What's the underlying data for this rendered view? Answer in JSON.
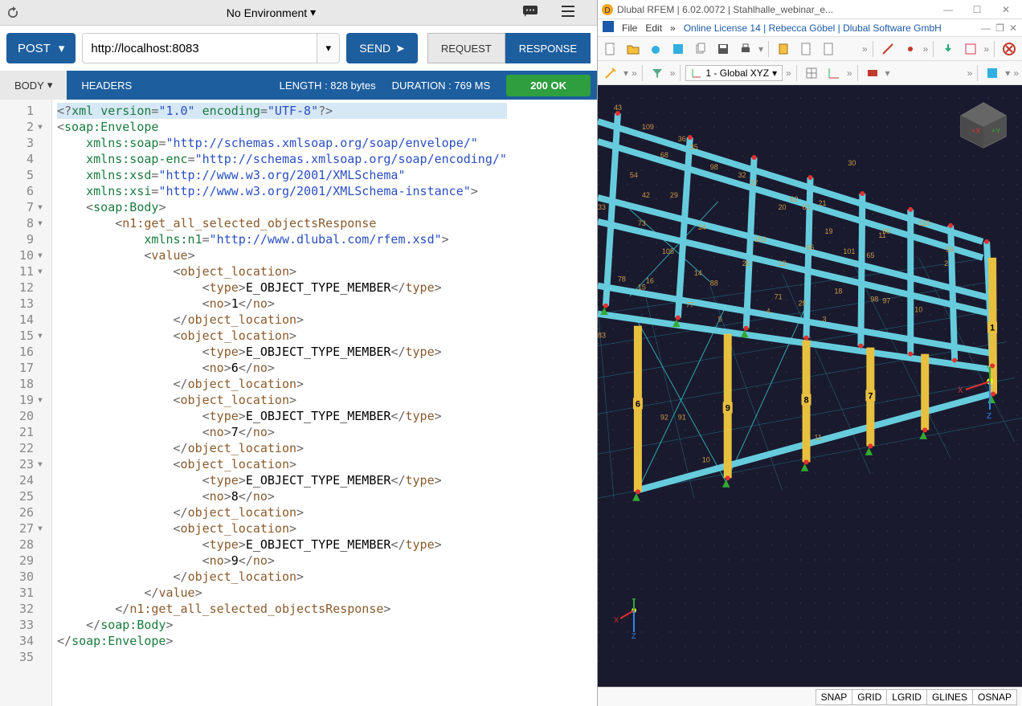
{
  "left": {
    "env_label": "No Environment",
    "method": "POST",
    "url": "http://localhost:8083",
    "send_label": "SEND",
    "request_tab": "REQUEST",
    "response_tab": "RESPONSE",
    "body_tab": "BODY",
    "headers_tab": "HEADERS",
    "length_label": "LENGTH : 828 bytes",
    "duration_label": "DURATION : 769 MS",
    "status_label": "200 OK",
    "code_lines": [
      {
        "n": 1,
        "fold": "",
        "hl": true,
        "html": "<span class='c-punc'>&lt;?</span><span class='c-tag'>xml</span> <span class='c-attr'>version</span><span class='c-punc'>=</span><span class='c-str'>\"1.0\"</span> <span class='c-attr'>encoding</span><span class='c-punc'>=</span><span class='c-str'>\"UTF-8\"</span><span class='c-punc'>?&gt;</span>"
      },
      {
        "n": 2,
        "fold": "▾",
        "html": "<span class='c-punc'>&lt;</span><span class='c-tag'>soap:Envelope</span>"
      },
      {
        "n": 3,
        "fold": "",
        "html": "    <span class='c-attr'>xmlns:soap</span><span class='c-punc'>=</span><span class='c-str'>\"http://schemas.xmlsoap.org/soap/envelope/\"</span>"
      },
      {
        "n": 4,
        "fold": "",
        "html": "    <span class='c-attr'>xmlns:soap-enc</span><span class='c-punc'>=</span><span class='c-str'>\"http://schemas.xmlsoap.org/soap/encoding/\"</span>"
      },
      {
        "n": 5,
        "fold": "",
        "html": "    <span class='c-attr'>xmlns:xsd</span><span class='c-punc'>=</span><span class='c-str'>\"http://www.w3.org/2001/XMLSchema\"</span>"
      },
      {
        "n": 6,
        "fold": "",
        "html": "    <span class='c-attr'>xmlns:xsi</span><span class='c-punc'>=</span><span class='c-str'>\"http://www.w3.org/2001/XMLSchema-instance\"</span><span class='c-punc'>&gt;</span>"
      },
      {
        "n": 7,
        "fold": "▾",
        "html": "    <span class='c-punc'>&lt;</span><span class='c-tag'>soap:Body</span><span class='c-punc'>&gt;</span>"
      },
      {
        "n": 8,
        "fold": "▾",
        "html": "        <span class='c-punc'>&lt;</span><span class='c-brown'>n1:get_all_selected_objectsResponse</span>"
      },
      {
        "n": 9,
        "fold": "",
        "html": "            <span class='c-attr'>xmlns:n1</span><span class='c-punc'>=</span><span class='c-str'>\"http://www.dlubal.com/rfem.xsd\"</span><span class='c-punc'>&gt;</span>"
      },
      {
        "n": 10,
        "fold": "▾",
        "html": "            <span class='c-punc'>&lt;</span><span class='c-brown'>value</span><span class='c-punc'>&gt;</span>"
      },
      {
        "n": 11,
        "fold": "▾",
        "html": "                <span class='c-punc'>&lt;</span><span class='c-brown'>object_location</span><span class='c-punc'>&gt;</span>"
      },
      {
        "n": 12,
        "fold": "",
        "html": "                    <span class='c-punc'>&lt;</span><span class='c-brown'>type</span><span class='c-punc'>&gt;</span><span class='c-text'>E_OBJECT_TYPE_MEMBER</span><span class='c-punc'>&lt;/</span><span class='c-brown'>type</span><span class='c-punc'>&gt;</span>"
      },
      {
        "n": 13,
        "fold": "",
        "html": "                    <span class='c-punc'>&lt;</span><span class='c-brown'>no</span><span class='c-punc'>&gt;</span><span class='c-text'>1</span><span class='c-punc'>&lt;/</span><span class='c-brown'>no</span><span class='c-punc'>&gt;</span>"
      },
      {
        "n": 14,
        "fold": "",
        "html": "                <span class='c-punc'>&lt;/</span><span class='c-brown'>object_location</span><span class='c-punc'>&gt;</span>"
      },
      {
        "n": 15,
        "fold": "▾",
        "html": "                <span class='c-punc'>&lt;</span><span class='c-brown'>object_location</span><span class='c-punc'>&gt;</span>"
      },
      {
        "n": 16,
        "fold": "",
        "html": "                    <span class='c-punc'>&lt;</span><span class='c-brown'>type</span><span class='c-punc'>&gt;</span><span class='c-text'>E_OBJECT_TYPE_MEMBER</span><span class='c-punc'>&lt;/</span><span class='c-brown'>type</span><span class='c-punc'>&gt;</span>"
      },
      {
        "n": 17,
        "fold": "",
        "html": "                    <span class='c-punc'>&lt;</span><span class='c-brown'>no</span><span class='c-punc'>&gt;</span><span class='c-text'>6</span><span class='c-punc'>&lt;/</span><span class='c-brown'>no</span><span class='c-punc'>&gt;</span>"
      },
      {
        "n": 18,
        "fold": "",
        "html": "                <span class='c-punc'>&lt;/</span><span class='c-brown'>object_location</span><span class='c-punc'>&gt;</span>"
      },
      {
        "n": 19,
        "fold": "▾",
        "html": "                <span class='c-punc'>&lt;</span><span class='c-brown'>object_location</span><span class='c-punc'>&gt;</span>"
      },
      {
        "n": 20,
        "fold": "",
        "html": "                    <span class='c-punc'>&lt;</span><span class='c-brown'>type</span><span class='c-punc'>&gt;</span><span class='c-text'>E_OBJECT_TYPE_MEMBER</span><span class='c-punc'>&lt;/</span><span class='c-brown'>type</span><span class='c-punc'>&gt;</span>"
      },
      {
        "n": 21,
        "fold": "",
        "html": "                    <span class='c-punc'>&lt;</span><span class='c-brown'>no</span><span class='c-punc'>&gt;</span><span class='c-text'>7</span><span class='c-punc'>&lt;/</span><span class='c-brown'>no</span><span class='c-punc'>&gt;</span>"
      },
      {
        "n": 22,
        "fold": "",
        "html": "                <span class='c-punc'>&lt;/</span><span class='c-brown'>object_location</span><span class='c-punc'>&gt;</span>"
      },
      {
        "n": 23,
        "fold": "▾",
        "html": "                <span class='c-punc'>&lt;</span><span class='c-brown'>object_location</span><span class='c-punc'>&gt;</span>"
      },
      {
        "n": 24,
        "fold": "",
        "html": "                    <span class='c-punc'>&lt;</span><span class='c-brown'>type</span><span class='c-punc'>&gt;</span><span class='c-text'>E_OBJECT_TYPE_MEMBER</span><span class='c-punc'>&lt;/</span><span class='c-brown'>type</span><span class='c-punc'>&gt;</span>"
      },
      {
        "n": 25,
        "fold": "",
        "html": "                    <span class='c-punc'>&lt;</span><span class='c-brown'>no</span><span class='c-punc'>&gt;</span><span class='c-text'>8</span><span class='c-punc'>&lt;/</span><span class='c-brown'>no</span><span class='c-punc'>&gt;</span>"
      },
      {
        "n": 26,
        "fold": "",
        "html": "                <span class='c-punc'>&lt;/</span><span class='c-brown'>object_location</span><span class='c-punc'>&gt;</span>"
      },
      {
        "n": 27,
        "fold": "▾",
        "html": "                <span class='c-punc'>&lt;</span><span class='c-brown'>object_location</span><span class='c-punc'>&gt;</span>"
      },
      {
        "n": 28,
        "fold": "",
        "html": "                    <span class='c-punc'>&lt;</span><span class='c-brown'>type</span><span class='c-punc'>&gt;</span><span class='c-text'>E_OBJECT_TYPE_MEMBER</span><span class='c-punc'>&lt;/</span><span class='c-brown'>type</span><span class='c-punc'>&gt;</span>"
      },
      {
        "n": 29,
        "fold": "",
        "html": "                    <span class='c-punc'>&lt;</span><span class='c-brown'>no</span><span class='c-punc'>&gt;</span><span class='c-text'>9</span><span class='c-punc'>&lt;/</span><span class='c-brown'>no</span><span class='c-punc'>&gt;</span>"
      },
      {
        "n": 30,
        "fold": "",
        "html": "                <span class='c-punc'>&lt;/</span><span class='c-brown'>object_location</span><span class='c-punc'>&gt;</span>"
      },
      {
        "n": 31,
        "fold": "",
        "html": "            <span class='c-punc'>&lt;/</span><span class='c-brown'>value</span><span class='c-punc'>&gt;</span>"
      },
      {
        "n": 32,
        "fold": "",
        "html": "        <span class='c-punc'>&lt;/</span><span class='c-brown'>n1:get_all_selected_objectsResponse</span><span class='c-punc'>&gt;</span>"
      },
      {
        "n": 33,
        "fold": "",
        "html": "    <span class='c-punc'>&lt;/</span><span class='c-tag'>soap:Body</span><span class='c-punc'>&gt;</span>"
      },
      {
        "n": 34,
        "fold": "",
        "html": "<span class='c-punc'>&lt;/</span><span class='c-tag'>soap:Envelope</span><span class='c-punc'>&gt;</span>"
      },
      {
        "n": 35,
        "fold": "",
        "html": ""
      }
    ]
  },
  "right": {
    "title": "Dlubal RFEM | 6.02.0072 | Stahlhalle_webinar_e...",
    "menu_file": "File",
    "menu_edit": "Edit",
    "license": "Online License 14 | Rebecca Göbel | Dlubal Software GmbH",
    "coord_system": "1 - Global XYZ",
    "status_buttons": [
      "SNAP",
      "GRID",
      "LGRID",
      "GLINES",
      "OSNAP"
    ],
    "axis_labels": {
      "x": "X",
      "y": "Y",
      "z": "Z",
      "px": "+X",
      "py": "+Y"
    },
    "selected_members": [
      "1",
      "6",
      "7",
      "8",
      "9"
    ],
    "node_labels": [
      "43",
      "109",
      "36",
      "35",
      "68",
      "54",
      "42",
      "29",
      "33",
      "73",
      "34",
      "72",
      "105",
      "14",
      "78",
      "15",
      "83",
      "77",
      "5",
      "88",
      "98",
      "103",
      "26",
      "13",
      "4",
      "29",
      "92",
      "91",
      "71",
      "65",
      "11",
      "48",
      "18",
      "98",
      "97",
      "59",
      "2",
      "101",
      "19",
      "60",
      "62",
      "32",
      "27",
      "20",
      "61",
      "21",
      "30",
      "10",
      "110",
      "1",
      "10",
      "3",
      "11",
      "16"
    ]
  }
}
